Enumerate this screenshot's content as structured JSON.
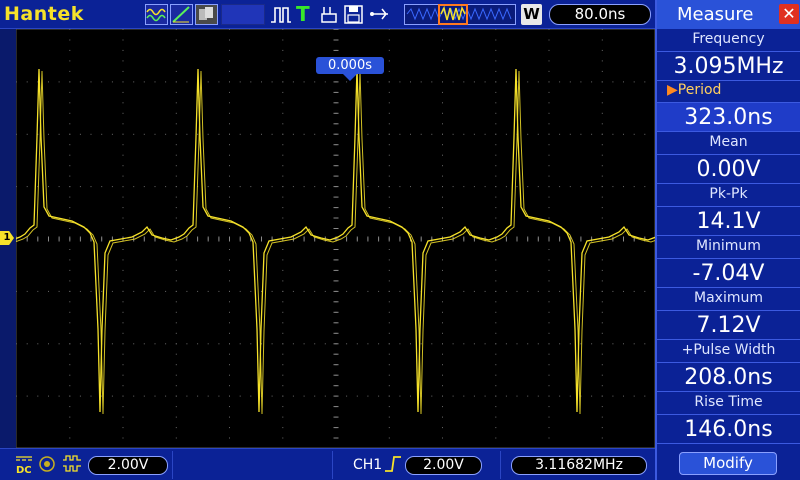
{
  "app": {
    "brand": "Hantek"
  },
  "topbar": {
    "timebase": "80.0ns",
    "window_badge": "W",
    "trigger_icon_letter": "T"
  },
  "screen": {
    "trigger_position": "0.000s",
    "channel_marker": "1",
    "trace_color": "#f6e22a"
  },
  "bottombar": {
    "ch1_volts_div": "2.00V",
    "trigger_channel": "CH1",
    "trigger_edge_icon": "rising-edge-icon",
    "trigger_level": "2.00V",
    "frequency_counter": "3.11682MHz"
  },
  "measure": {
    "title": "Measure",
    "items": [
      {
        "label": "Frequency",
        "value": "3.095MHz"
      },
      {
        "label": "Period",
        "value": "323.0ns",
        "active": true
      },
      {
        "label": "Mean",
        "value": "0.00V"
      },
      {
        "label": "Pk-Pk",
        "value": "14.1V"
      },
      {
        "label": "Minimum",
        "value": "-7.04V"
      },
      {
        "label": "Maximum",
        "value": "7.12V"
      },
      {
        "label": "+Pulse Width",
        "value": "208.0ns"
      },
      {
        "label": "Rise Time",
        "value": "146.0ns"
      }
    ],
    "modify_label": "Modify"
  },
  "colors": {
    "brand_yellow": "#f6e22a",
    "panel_blue": "#0b2296",
    "accent_blue": "#2a52d8",
    "close_red": "#e03020",
    "window_orange": "#ff7a20"
  }
}
